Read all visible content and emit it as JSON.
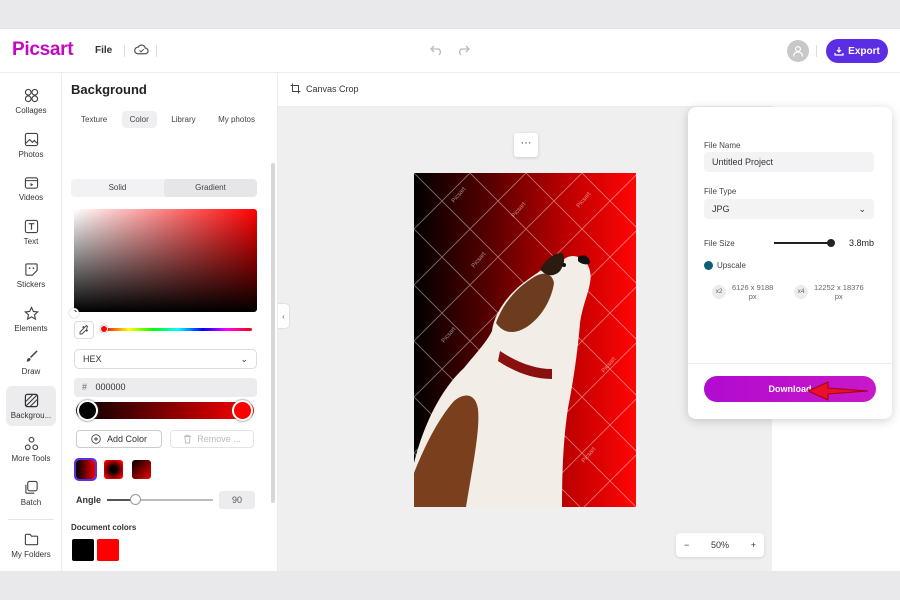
{
  "topbar": {
    "logo": "Picsart",
    "file_menu": "File",
    "export_label": "Export"
  },
  "rail": {
    "items": [
      {
        "label": "Collages",
        "icon": "collages-icon"
      },
      {
        "label": "Photos",
        "icon": "photos-icon"
      },
      {
        "label": "Videos",
        "icon": "videos-icon"
      },
      {
        "label": "Text",
        "icon": "text-icon"
      },
      {
        "label": "Stickers",
        "icon": "stickers-icon"
      },
      {
        "label": "Elements",
        "icon": "elements-icon"
      },
      {
        "label": "Draw",
        "icon": "draw-icon"
      },
      {
        "label": "Backgrou...",
        "icon": "background-icon",
        "active": true
      },
      {
        "label": "More Tools",
        "icon": "more-tools-icon"
      },
      {
        "label": "Batch",
        "icon": "batch-icon"
      },
      {
        "label": "My Folders",
        "icon": "folder-icon"
      }
    ]
  },
  "panel": {
    "title": "Background",
    "tabs": [
      "Texture",
      "Color",
      "Library",
      "My photos"
    ],
    "active_tab": "Color",
    "fill_modes": [
      "Solid",
      "Gradient"
    ],
    "active_fill_mode": "Gradient",
    "format_select": "HEX",
    "hex_symbol": "#",
    "hex_value": "000000",
    "add_color_label": "Add Color",
    "remove_label": "Remove ...",
    "angle_label": "Angle",
    "angle_value": "90",
    "document_colors_label": "Document colors",
    "colors": {
      "gradient_start": "#000000",
      "gradient_end": "#ff0000",
      "accent": "#c209c1"
    }
  },
  "canvas": {
    "crop_label": "Canvas Crop",
    "more_label": "···",
    "watermark": "Picsart",
    "zoom_minus": "−",
    "zoom_value": "50%",
    "zoom_plus": "+",
    "collapse_glyph": "‹"
  },
  "export_popup": {
    "file_name_label": "File Name",
    "file_name_value": "Untitled Project",
    "file_type_label": "File Type",
    "file_type_value": "JPG",
    "file_size_label": "File Size",
    "file_size_value": "3.8mb",
    "upscale_label": "Upscale",
    "upscale_options": [
      {
        "mult": "x2",
        "res_line1": "6126 x 9188",
        "res_line2": "px"
      },
      {
        "mult": "x4",
        "res_line1": "12252 x 18376",
        "res_line2": "px"
      }
    ],
    "download_label": "Download"
  }
}
